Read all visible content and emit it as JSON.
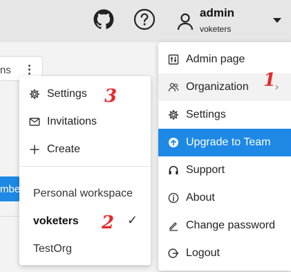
{
  "header": {
    "user_name": "admin",
    "user_sub": "voketers"
  },
  "background": {
    "card_label": "ns",
    "button_label": "mbe"
  },
  "submenu": {
    "items": [
      {
        "label": "Settings",
        "icon": "gear-icon"
      },
      {
        "label": "Invitations",
        "icon": "envelope-icon"
      },
      {
        "label": "Create",
        "icon": "plus-icon"
      }
    ],
    "workspaces": [
      {
        "label": "Personal workspace"
      },
      {
        "label": "voketers",
        "selected": true
      },
      {
        "label": "TestOrg"
      }
    ],
    "check": "✓"
  },
  "menu": {
    "items": [
      {
        "label": "Admin page",
        "icon": "admin-panel-icon"
      },
      {
        "label": "Organization",
        "icon": "organization-icon"
      },
      {
        "label": "Settings",
        "icon": "gear-icon"
      },
      {
        "label": "Upgrade to Team",
        "icon": "upgrade-icon"
      },
      {
        "label": "Support",
        "icon": "headset-icon"
      },
      {
        "label": "About",
        "icon": "info-icon"
      },
      {
        "label": "Change password",
        "icon": "pencil-icon"
      },
      {
        "label": "Logout",
        "icon": "logout-icon"
      }
    ],
    "chevron": "›"
  },
  "annotations": {
    "a1": "1",
    "a2": "2",
    "a3": "3"
  },
  "colors": {
    "accent": "#1e88e5",
    "annotation": "#e8292c"
  }
}
